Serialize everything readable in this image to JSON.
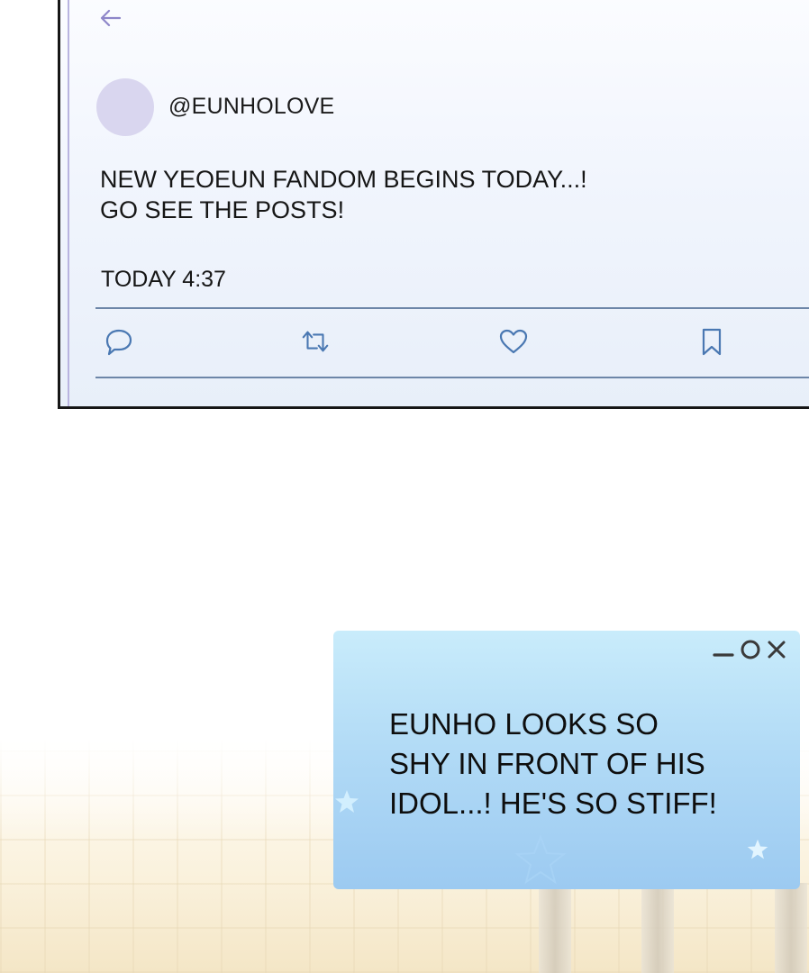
{
  "tweet": {
    "handle": "@EUNHOLOVE",
    "text_lines": [
      "NEW YEOEUN FANDOM BEGINS TODAY...!",
      "GO SEE THE POSTS!"
    ],
    "timestamp": "TODAY 4:37",
    "icons": {
      "back": "back-arrow-icon",
      "reply": "reply-icon",
      "retweet": "retweet-icon",
      "like": "heart-icon",
      "bookmark": "bookmark-icon"
    }
  },
  "popup": {
    "text_lines": [
      "EUNHO LOOKS SO",
      "SHY IN FRONT OF HIS",
      "IDOL...! HE'S SO STIFF!"
    ],
    "controls": [
      "minimize-icon",
      "maximize-icon",
      "close-icon"
    ]
  },
  "colors": {
    "accent": "#8e86c9",
    "icon_blue": "#4a78b2",
    "popup_bg": "#b2dbf6"
  }
}
